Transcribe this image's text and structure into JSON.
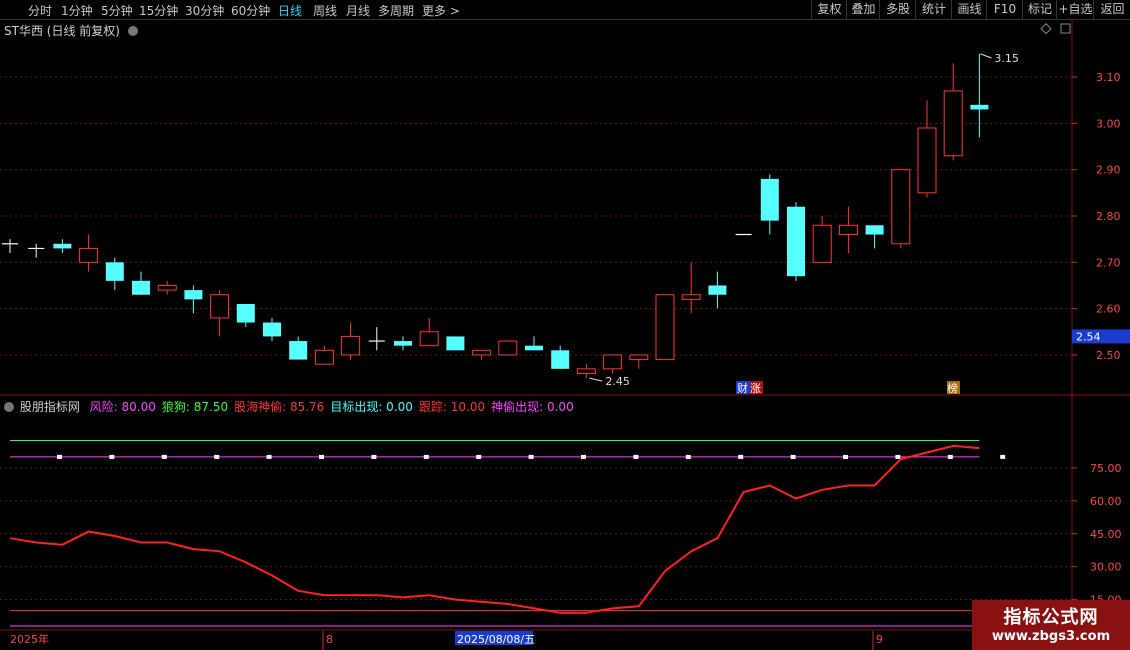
{
  "toolbar": {
    "periods": [
      "分时",
      "1分钟",
      "5分钟",
      "15分钟",
      "30分钟",
      "60分钟",
      "日线",
      "周线",
      "月线",
      "多周期",
      "更多 >"
    ],
    "active_index": 6,
    "right_buttons": [
      "复权",
      "叠加",
      "多股",
      "统计",
      "画线",
      "F10",
      "标记",
      "+自选",
      "返回"
    ]
  },
  "stock": {
    "title": "ST华西 (日线 前复权)"
  },
  "indicator": {
    "name": "股朋指标网",
    "items": [
      {
        "label": "风险: 80.00",
        "color": "#ff44ff"
      },
      {
        "label": "狼狗: 87.50",
        "color": "#33ff33"
      },
      {
        "label": "股海神偷: 85.76",
        "color": "#ff3333"
      },
      {
        "label": "目标出现: 0.00",
        "color": "#44ffff"
      },
      {
        "label": "跟踪: 10.00",
        "color": "#ff3333"
      },
      {
        "label": "神偷出现: 0.00",
        "color": "#ff44ff"
      }
    ]
  },
  "markers": {
    "low": "2.45",
    "high": "3.15",
    "cai": "财",
    "zhang": "涨",
    "bang": "榜",
    "current": "2.54"
  },
  "date_axis": {
    "d1": "2025年",
    "d2": "8",
    "d3": "2025/08/08/五",
    "d4": "9"
  },
  "watermark": {
    "line1": "指标公式网",
    "line2": "www.zbgs3.com"
  },
  "colors": {
    "up": "#ff3333",
    "down": "#55ffff",
    "line": "#ff2020",
    "grid": "#7a1010"
  },
  "chart_data": [
    {
      "type": "candlestick",
      "title": "ST华西 (日线 前复权)",
      "ylim": [
        2.42,
        3.18
      ],
      "y_ticks": [
        2.5,
        2.6,
        2.7,
        2.8,
        2.9,
        3.0,
        3.1
      ],
      "candles": [
        {
          "o": 2.74,
          "c": 2.74,
          "h": 2.75,
          "l": 2.72
        },
        {
          "o": 2.73,
          "c": 2.73,
          "h": 2.74,
          "l": 2.71
        },
        {
          "o": 2.74,
          "c": 2.73,
          "h": 2.75,
          "l": 2.72
        },
        {
          "o": 2.7,
          "c": 2.73,
          "h": 2.76,
          "l": 2.68
        },
        {
          "o": 2.7,
          "c": 2.66,
          "h": 2.71,
          "l": 2.64
        },
        {
          "o": 2.66,
          "c": 2.63,
          "h": 2.68,
          "l": 2.63
        },
        {
          "o": 2.64,
          "c": 2.65,
          "h": 2.66,
          "l": 2.63
        },
        {
          "o": 2.64,
          "c": 2.62,
          "h": 2.65,
          "l": 2.59
        },
        {
          "o": 2.58,
          "c": 2.63,
          "h": 2.64,
          "l": 2.54
        },
        {
          "o": 2.61,
          "c": 2.57,
          "h": 2.61,
          "l": 2.56
        },
        {
          "o": 2.57,
          "c": 2.54,
          "h": 2.58,
          "l": 2.53
        },
        {
          "o": 2.53,
          "c": 2.49,
          "h": 2.54,
          "l": 2.49
        },
        {
          "o": 2.48,
          "c": 2.51,
          "h": 2.52,
          "l": 2.48
        },
        {
          "o": 2.5,
          "c": 2.54,
          "h": 2.57,
          "l": 2.49
        },
        {
          "o": 2.53,
          "c": 2.53,
          "h": 2.56,
          "l": 2.51
        },
        {
          "o": 2.53,
          "c": 2.52,
          "h": 2.54,
          "l": 2.51
        },
        {
          "o": 2.52,
          "c": 2.55,
          "h": 2.58,
          "l": 2.52
        },
        {
          "o": 2.54,
          "c": 2.51,
          "h": 2.54,
          "l": 2.51
        },
        {
          "o": 2.5,
          "c": 2.51,
          "h": 2.51,
          "l": 2.49
        },
        {
          "o": 2.5,
          "c": 2.53,
          "h": 2.53,
          "l": 2.5
        },
        {
          "o": 2.52,
          "c": 2.51,
          "h": 2.54,
          "l": 2.51
        },
        {
          "o": 2.51,
          "c": 2.47,
          "h": 2.52,
          "l": 2.47
        },
        {
          "o": 2.46,
          "c": 2.47,
          "h": 2.48,
          "l": 2.45
        },
        {
          "o": 2.47,
          "c": 2.5,
          "h": 2.5,
          "l": 2.46
        },
        {
          "o": 2.49,
          "c": 2.5,
          "h": 2.5,
          "l": 2.47
        },
        {
          "o": 2.49,
          "c": 2.63,
          "h": 2.63,
          "l": 2.49
        },
        {
          "o": 2.62,
          "c": 2.63,
          "h": 2.7,
          "l": 2.59
        },
        {
          "o": 2.65,
          "c": 2.63,
          "h": 2.68,
          "l": 2.6
        },
        {
          "o": 2.76,
          "c": 2.76,
          "h": 2.76,
          "l": 2.76
        },
        {
          "o": 2.88,
          "c": 2.79,
          "h": 2.89,
          "l": 2.76
        },
        {
          "o": 2.82,
          "c": 2.67,
          "h": 2.83,
          "l": 2.66
        },
        {
          "o": 2.7,
          "c": 2.78,
          "h": 2.8,
          "l": 2.7
        },
        {
          "o": 2.76,
          "c": 2.78,
          "h": 2.82,
          "l": 2.72
        },
        {
          "o": 2.78,
          "c": 2.76,
          "h": 2.78,
          "l": 2.73
        },
        {
          "o": 2.74,
          "c": 2.9,
          "h": 2.9,
          "l": 2.73
        },
        {
          "o": 2.85,
          "c": 2.99,
          "h": 3.05,
          "l": 2.84
        },
        {
          "o": 2.93,
          "c": 3.07,
          "h": 3.13,
          "l": 2.92
        },
        {
          "o": 3.04,
          "c": 3.03,
          "h": 3.15,
          "l": 2.97
        }
      ]
    },
    {
      "type": "line",
      "title": "股朋指标网",
      "ylim": [
        8,
        100
      ],
      "y_ticks": [
        15.0,
        30.0,
        45.0,
        60.0,
        75.0
      ],
      "series": [
        {
          "name": "股海神偷",
          "values": [
            43,
            41,
            40,
            46,
            44,
            41,
            41,
            38,
            37,
            32,
            26,
            19,
            17,
            17,
            17,
            16,
            17,
            15,
            14,
            13,
            11,
            9,
            9,
            11,
            12,
            28,
            37,
            43,
            64,
            67,
            61,
            65,
            67,
            67,
            79,
            82,
            85,
            84
          ]
        }
      ],
      "hlines": [
        {
          "value": 87.5,
          "color": "#33ff33"
        },
        {
          "value": 80,
          "color": "#ff44ff"
        },
        {
          "value": 10,
          "color": "#ff3333"
        },
        {
          "value": 0,
          "color": "#ff44ff"
        }
      ]
    }
  ]
}
